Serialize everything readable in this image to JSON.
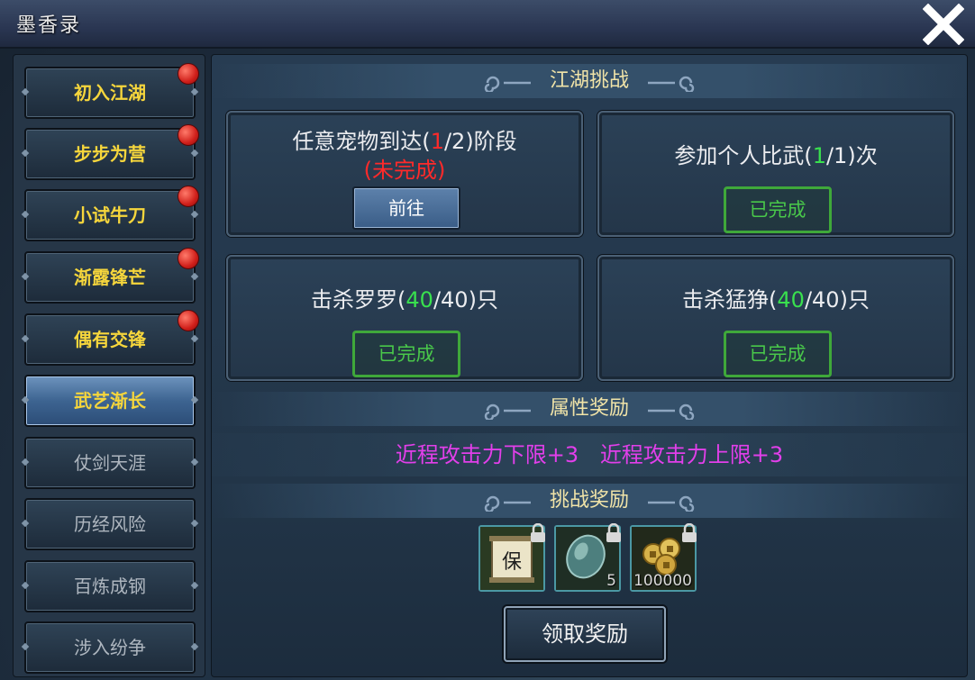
{
  "window": {
    "title": "墨香录"
  },
  "sidebar": {
    "items": [
      {
        "label": "初入江湖",
        "state": "yellow",
        "dot": true
      },
      {
        "label": "步步为营",
        "state": "yellow",
        "dot": true
      },
      {
        "label": "小试牛刀",
        "state": "yellow",
        "dot": true
      },
      {
        "label": "渐露锋芒",
        "state": "yellow",
        "dot": true
      },
      {
        "label": "偶有交锋",
        "state": "yellow",
        "dot": true
      },
      {
        "label": "武艺渐长",
        "state": "active",
        "dot": false
      },
      {
        "label": "仗剑天涯",
        "state": "grey",
        "dot": false
      },
      {
        "label": "历经风险",
        "state": "grey",
        "dot": false
      },
      {
        "label": "百炼成钢",
        "state": "grey",
        "dot": false
      },
      {
        "label": "涉入纷争",
        "state": "grey",
        "dot": false
      }
    ]
  },
  "sections": {
    "challenge_title": "江湖挑战",
    "attr_title": "属性奖励",
    "reward_title": "挑战奖励"
  },
  "tasks": [
    {
      "prefix": "任意宠物到达(",
      "num": "1",
      "suffix": "/2)阶段",
      "num_color": "red",
      "status": "(未完成)",
      "button": "前往"
    },
    {
      "prefix": "参加个人比武(",
      "num": "1",
      "suffix": "/1)次",
      "num_color": "green",
      "button": "已完成"
    },
    {
      "prefix": "击杀罗罗(",
      "num": "40",
      "suffix": "/40)只",
      "num_color": "green",
      "button": "已完成"
    },
    {
      "prefix": "击杀猛狰(",
      "num": "40",
      "suffix": "/40)只",
      "num_color": "green",
      "button": "已完成"
    }
  ],
  "attr_rewards": [
    "近程攻击力下限+3",
    "近程攻击力上限+3"
  ],
  "rewards": [
    {
      "icon": "scroll-icon",
      "count": ""
    },
    {
      "icon": "gem-icon",
      "count": "5"
    },
    {
      "icon": "coins-icon",
      "count": "100000"
    }
  ],
  "claim_button": "领取奖励",
  "colors": {
    "yellow": "#f6d63c",
    "red": "#ff2a2a",
    "green": "#39e04e",
    "purple": "#e23fea",
    "done_green": "#49c84a"
  }
}
